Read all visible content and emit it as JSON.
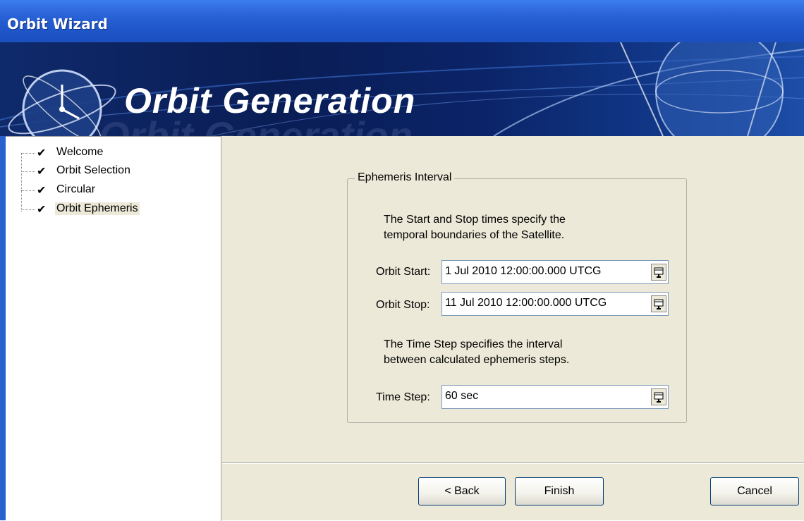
{
  "window": {
    "title": "Orbit Wizard"
  },
  "banner": {
    "title": "Orbit Generation",
    "ghost_text": "Orbit Generation"
  },
  "steps": [
    {
      "label": "Welcome",
      "checked": true
    },
    {
      "label": "Orbit Selection",
      "checked": true
    },
    {
      "label": "Circular",
      "checked": true
    },
    {
      "label": "Orbit Ephemeris",
      "checked": true,
      "selected": true
    }
  ],
  "ephemeris": {
    "group_title": "Ephemeris Interval",
    "desc1_line1": "The Start and Stop times specify the",
    "desc1_line2": "temporal boundaries of the Satellite.",
    "start_label": "Orbit Start:",
    "start_value": "1 Jul 2010 12:00:00.000 UTCG",
    "stop_label": "Orbit Stop:",
    "stop_value": "11 Jul 2010 12:00:00.000 UTCG",
    "desc2_line1": "The Time Step specifies the interval",
    "desc2_line2": "between calculated ephemeris steps.",
    "step_label": "Time Step:",
    "step_value": "60 sec"
  },
  "buttons": {
    "back": "< Back",
    "finish": "Finish",
    "cancel": "Cancel"
  },
  "icons": {
    "check": "check-icon",
    "picker": "calendar-picker-icon",
    "logo": "clock-globe-icon"
  },
  "colors": {
    "titlebar": "#2a63d8",
    "banner": "#0a1d55",
    "panel": "#ece9d8"
  }
}
